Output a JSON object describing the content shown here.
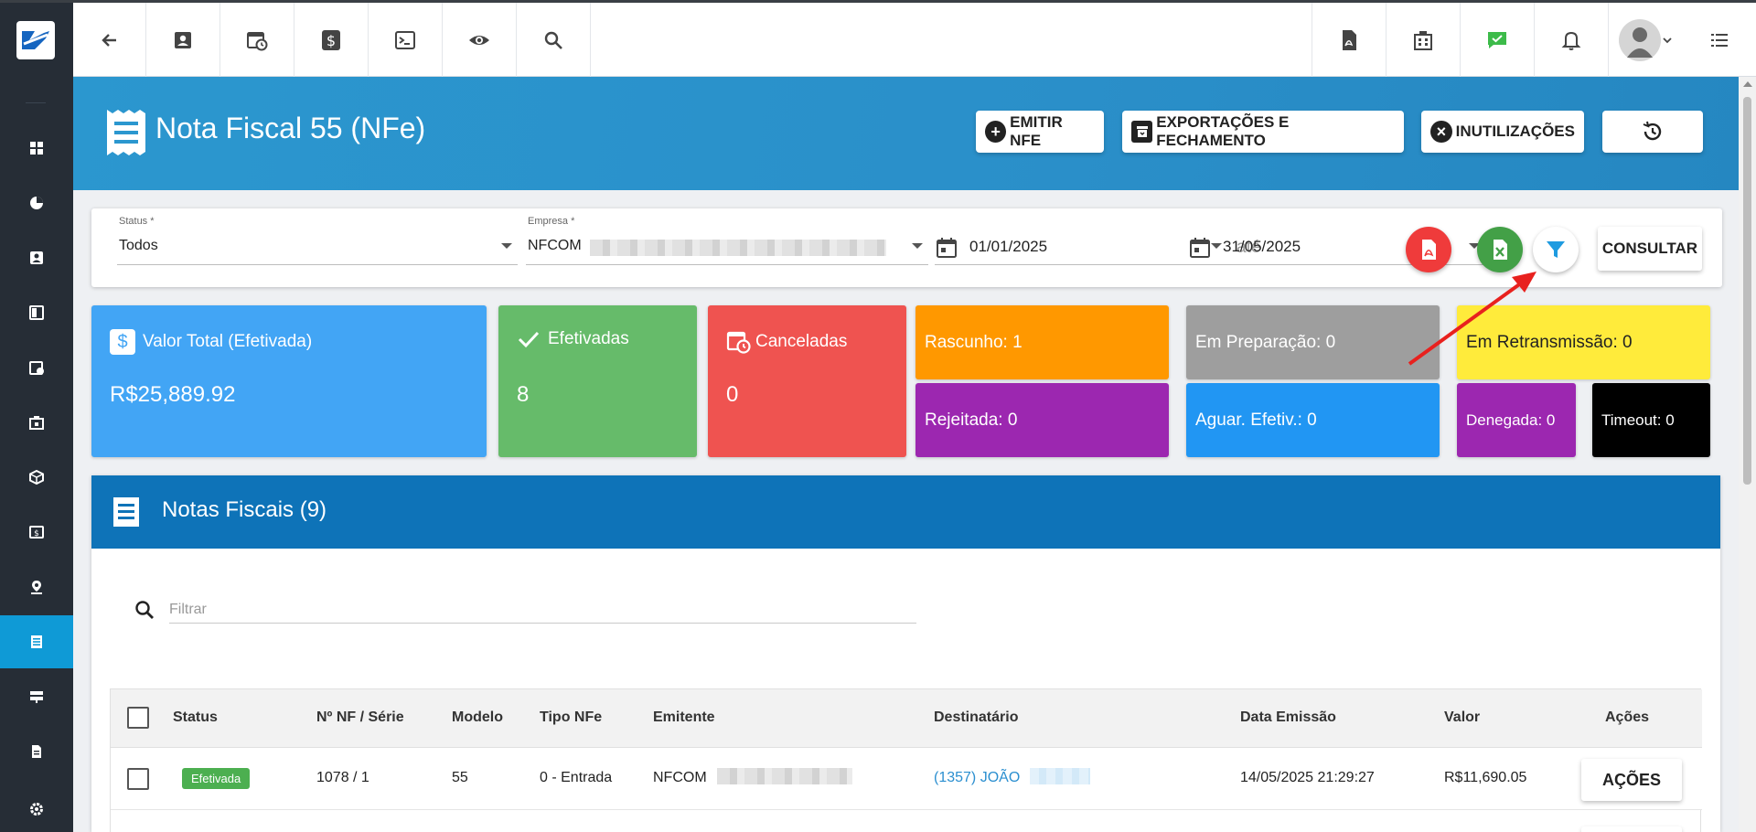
{
  "topbar": {
    "left_icons": [
      "back-arrow-icon",
      "contact-card-icon",
      "calendar-clock-icon",
      "dollar-icon",
      "terminal-icon",
      "eye-icon",
      "search-icon"
    ],
    "right_icons": [
      "pdf-icon",
      "building-icon",
      "chat-check-icon",
      "bell-icon",
      "avatar",
      "menu-icon"
    ]
  },
  "sidebar": {
    "items": [
      "dashboard-icon",
      "pie-chart-icon",
      "contact-icon",
      "board-icon",
      "calendar-icon",
      "store-icon",
      "package-icon",
      "money-icon",
      "map-pin-icon",
      "invoice-icon",
      "server-icon",
      "document-icon",
      "settings-icon"
    ],
    "active_index": 9
  },
  "header": {
    "title": "Nota Fiscal 55 (NFe)",
    "btn_emitir": "EMITIR NFE",
    "btn_exportacoes": "EXPORTAÇÕES E FECHAMENTO",
    "btn_inutilizacoes": "INUTILIZAÇÕES"
  },
  "filters": {
    "status_label": "Status *",
    "status_value": "Todos",
    "empresa_label": "Empresa *",
    "empresa_value": "NFCOM",
    "date_from": "01/01/2025",
    "date_sep": "até",
    "date_to": "31/05/2025",
    "consultar": "CONSULTAR"
  },
  "cards": {
    "valor_total_label": "Valor Total (Efetivada)",
    "valor_total_value": "R$25,889.92",
    "efetivadas_label": "Efetivadas",
    "efetivadas_value": "8",
    "canceladas_label": "Canceladas",
    "canceladas_value": "0"
  },
  "stats": {
    "rascunho": "Rascunho: 1",
    "rejeitada": "Rejeitada: 0",
    "em_preparacao": "Em Preparação: 0",
    "aguar_efetiv": "Aguar. Efetiv.: 0",
    "em_retransmissao": "Em Retransmissão: 0",
    "denegada": "Denegada: 0",
    "timeout": "Timeout: 0"
  },
  "colors": {
    "primary": "#0e73b8",
    "valor_total": "#42a5f5",
    "efetivadas": "#66bb6a",
    "canceladas": "#ef5350",
    "rascunho": "#ff9800",
    "rejeitada": "#9c27b0",
    "em_preparacao": "#9e9e9e",
    "aguar_efetiv": "#2196f3",
    "em_retransmissao": "#ffeb3b",
    "denegada": "#9c27b0",
    "timeout": "#000000",
    "pdf_button": "#ef3b3b",
    "excel_button": "#43a047"
  },
  "notas": {
    "title": "Notas Fiscais (9)",
    "filter_placeholder": "Filtrar",
    "columns": [
      "Status",
      "Nº NF / Série",
      "Modelo",
      "Tipo NFe",
      "Emitente",
      "Destinatário",
      "Data Emissão",
      "Valor",
      "Ações"
    ],
    "rows": [
      {
        "status": "Efetivada",
        "numero": "1078 / 1",
        "modelo": "55",
        "tipo": "0 - Entrada",
        "emitente": "NFCOM",
        "destinatario": "(1357) JOÃO",
        "data": "14/05/2025 21:29:27",
        "valor": "R$11,690.05",
        "acoes": "AÇÕES"
      }
    ]
  }
}
